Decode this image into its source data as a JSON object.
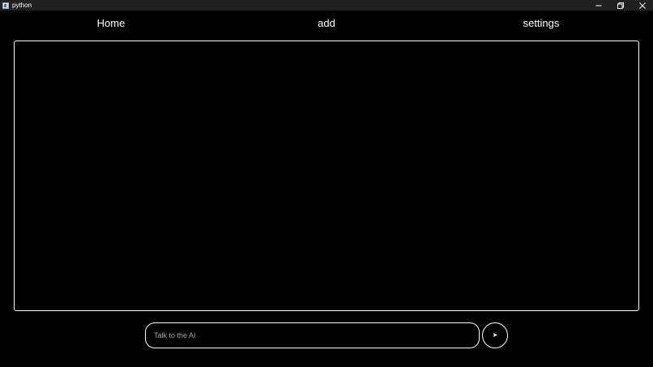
{
  "window": {
    "title": "python",
    "icon": "python-app-icon",
    "controls": [
      "minimize-icon",
      "restore-icon",
      "close-icon"
    ]
  },
  "nav": {
    "items": [
      {
        "label": "Home"
      },
      {
        "label": "add"
      },
      {
        "label": "settings"
      }
    ]
  },
  "chat": {
    "messages": []
  },
  "input": {
    "value": "",
    "placeholder": "Talk to the AI"
  },
  "send": {
    "icon": "send-arrow-icon",
    "glyph": "➤"
  },
  "colors": {
    "background": "#000000",
    "foreground": "#ffffff",
    "titlebar": "#202020",
    "placeholder": "#a8a8a8"
  }
}
